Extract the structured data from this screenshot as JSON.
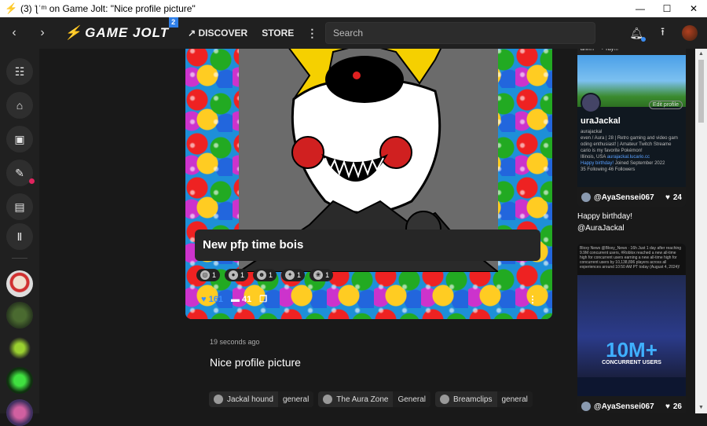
{
  "window": {
    "title": "(3) ƪʿᵐ on Game Jolt: \"Nice profile picture\"",
    "minimize": "—",
    "maximize": "☐",
    "close": "✕"
  },
  "topbar": {
    "back": "‹",
    "forward": "›",
    "logo_text": "GAME JOLT",
    "logo_badge": "2",
    "discover_label": "DISCOVER",
    "store_label": "STORE",
    "more_label": "⋮",
    "search_placeholder": "Search"
  },
  "post": {
    "title": "New pfp time bois",
    "reactions": [
      {
        "emoji": "◎",
        "count": "1"
      },
      {
        "emoji": "●",
        "count": "1"
      },
      {
        "emoji": "☻",
        "count": "1"
      },
      {
        "emoji": "✦",
        "count": "1"
      },
      {
        "emoji": "❀",
        "count": "1"
      }
    ],
    "likes": "161",
    "comments": "41",
    "menu": "⋮"
  },
  "comment": {
    "timestamp": "19 seconds ago",
    "text": "Nice profile picture"
  },
  "tags": [
    {
      "name": "Jackal hound",
      "channel": "general"
    },
    {
      "name": "The Aura Zone",
      "channel": "General"
    },
    {
      "name": "Breamclips",
      "channel": "general"
    }
  ],
  "right": {
    "card1_top": "anri!!! ™• Yay!!!",
    "card1_edit": "Edit profile",
    "card1_name": "uraJackal",
    "card1_handle": "aurajackal",
    "card1_bio": "even / Aura | 28 | Retro gaming and video gam oding enthusiast! | Amateur Twitch Streame cario is my favorite Pokémon!",
    "card1_location": "Illinois, USA",
    "card1_site": "aurajackal.lucario.cc",
    "card1_birthday": "Happy birthday!",
    "card1_joined": "Joined September 2022",
    "card1_following": "35 Following",
    "card1_followers": "46 Followers",
    "card1_user": "@AyaSensei067",
    "card1_likes": "24",
    "text_line1": "Happy birthday!",
    "text_line2": "@AuraJackal",
    "card2_head": "Bloxy News @Bloxy_News · 16h Just 1 day after reaching 9.9M concurrent users, #Roblox reached a new all-time high for concurrent users earning a new all-time high for concurrent users by 10,138,896 players across all experiences around 10:50 AM PT today (August 4, 2024)!",
    "card2_big": "10M+",
    "card2_sub": "CONCURRENT USERS",
    "card2_user": "@AyaSensei067",
    "card2_likes": "26"
  },
  "colors": {
    "accent_blue": "#3a8fff",
    "notif_pink": "#e0245e"
  }
}
